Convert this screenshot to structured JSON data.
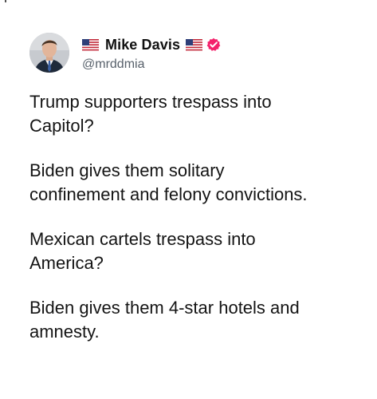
{
  "tweet": {
    "author": {
      "display_name": "Mike Davis",
      "handle": "@mrddmia",
      "avatar_icon": "profile-photo",
      "verified": true,
      "verified_color": "#f4216b",
      "name_decorations": [
        "us-flag-icon",
        "us-flag-icon"
      ]
    },
    "paragraphs": [
      "Trump supporters trespass into\nCapitol?",
      "Biden gives them solitary\nconfinement and felony convictions.",
      "Mexican cartels trespass into\nAmerica?",
      "Biden gives them 4-star hotels and\namnesty."
    ]
  }
}
